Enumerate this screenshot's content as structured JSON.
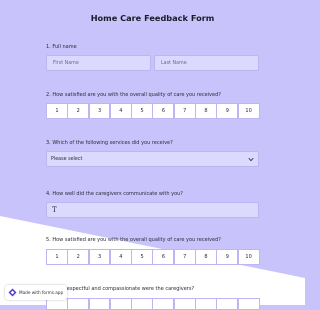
{
  "form": {
    "title": "Home Care Feedback Form",
    "q1": {
      "label": "1.  Full name",
      "first_placeholder": "First Name",
      "last_placeholder": "Last Name"
    },
    "q2": {
      "label": "2.  How satisfied are you with the overall quality of care you received?",
      "options": [
        "1",
        "2",
        "3",
        "4",
        "5",
        "6",
        "7",
        "8",
        "9",
        "10"
      ]
    },
    "q3": {
      "label": "3.  Which of the following services did you receive?",
      "value": "Please select"
    },
    "q4": {
      "label": "4.  How well did the caregivers communicate with you?"
    },
    "q5": {
      "label": "5.  How satisfied are you with the overall quality of care you received?",
      "options": [
        "1",
        "2",
        "3",
        "4",
        "5",
        "6",
        "7",
        "8",
        "9",
        "10"
      ]
    },
    "q6": {
      "label": "6.  How respectful and compassionate were the caregivers?"
    }
  },
  "badge": {
    "text": "Made with forms.app"
  },
  "colors": {
    "background": "#c9c3fc",
    "field": "#ddd9fe",
    "border": "#bdb6f3",
    "logo": "#4f3fd8"
  },
  "icons": {
    "select": "chevron-down-icon",
    "textarea": "text-format-icon",
    "badge": "formsapp-logo-icon"
  }
}
